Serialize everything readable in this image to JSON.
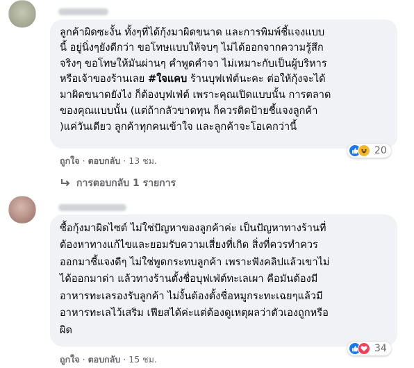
{
  "comments": [
    {
      "lines": [
        "ลูกค้าผิดซะงั้น ทั้งๆที่ได้กุ้งมาผิดขนาด และการพิมพ์ชี้แจงแบบ",
        "นี้ อยู่นิ่งๆยังดีกว่า ขอโทษแบบให้จบๆ ไม่ได้ออกจากความรู้สึก",
        "จริงๆ ขอโทษให้มันผ่านๆ คำพูดคำจา ไม่เหมาะกับเป็นผู้บริหาร",
        "ร้านบุฟเฟ่ต์นะคะ ต่อให้กุ้งจะได้",
        "มาผิดขนาดยังไง ก็ต้องบุฟเฟ่ต์ เพราะคุณเปิดแบบนั้น การตลาด",
        "ของคุณแบบนั้น (แต่ถ้ากลัวขาดทุน ก็ควรติดป้ายชี้แจงลูกค้า",
        ")แค่วันเดียว ลูกค้าทุกคนเข้าใจ และลูกค้าจะโอเคกว่านี้"
      ],
      "line4_prefix": "หรือเจ้าของร้านเลย ",
      "hashtag": "#ใจแคบ",
      "reaction_count": "20",
      "like_label": "ถูกใจ",
      "reply_label": "ตอบกลับ",
      "separator": "·",
      "time": "13 ชม."
    },
    {
      "lines": [
        "ซื้อกุ้งมาผิดไซต์ ไม่ใช่ปัญหาของลูกค้าค่ะ เป็นปัญหาทางร้านที่",
        "ต้องหาทางแก้ไขและยอมรับความเสี่ยงที่เกิด สิ่งที่ควรทำควร",
        "ออกมาชี้แจงดีๆ ไม่ใช่พูดกระทบลูกค้า เพราะฟังคลิปแล้วเขาไม่",
        "ได้ออกมาด่า แล้วทางร้านตั้งชื่อบุฟเฟ่ต์ทะเลเผา คือมันต้องมี",
        "อาหารทะเลรองรับลูกค้า ไม่งั้นต้องตั้งชื่อหมูกระทะเฉยๆแล้วมี",
        "อาหารทะเลไว้เสริม เฟียสได้ค่ะแต่ต้องดูเหตุผลว่าตัวเองถูกหรือ",
        "ผิด"
      ],
      "reaction_count": "34",
      "like_label": "ถูกใจ",
      "reply_label": "ตอบกลับ",
      "separator": "·",
      "time": "15 ชม."
    }
  ],
  "replies_link": "การตอบกลับ 1 รายการ",
  "icons": {
    "like": "thumbs-up-icon",
    "haha": "laughing-face-icon",
    "love": "heart-icon",
    "reply_arrow": "reply-arrow-icon"
  },
  "colors": {
    "bubble": "#f0f2f5",
    "text": "#050505",
    "secondary": "#65676b",
    "like": "#1877f2",
    "haha": "#f7b928",
    "love": "#f33e58"
  }
}
